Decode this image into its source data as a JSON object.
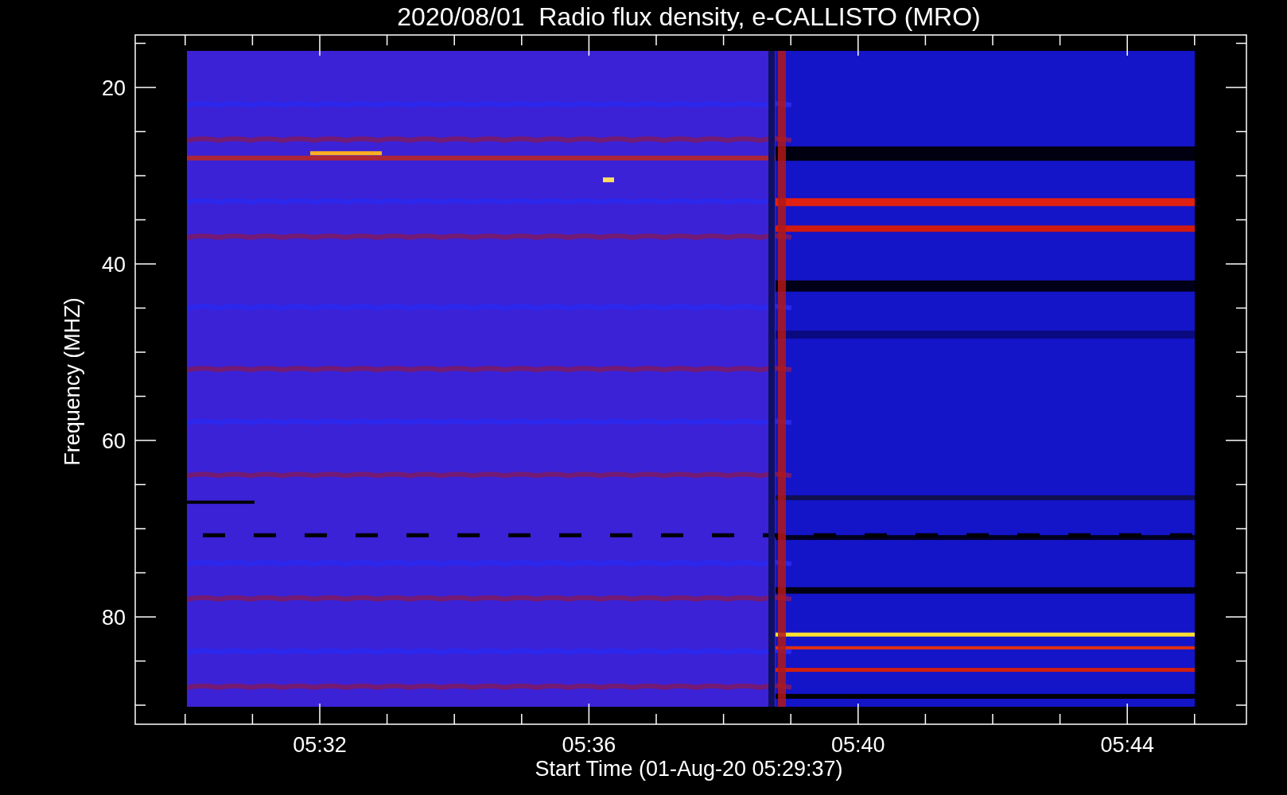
{
  "title": "2020/08/01  Radio flux density, e-CALLISTO (MRO)",
  "y_axis": {
    "label": "Frequency (MHZ)",
    "ticks": [
      "20",
      "40",
      "60",
      "80"
    ]
  },
  "x_axis": {
    "label": "Start Time (01-Aug-20 05:29:37)",
    "ticks": [
      "05:32",
      "05:36",
      "05:40",
      "05:44"
    ]
  }
}
